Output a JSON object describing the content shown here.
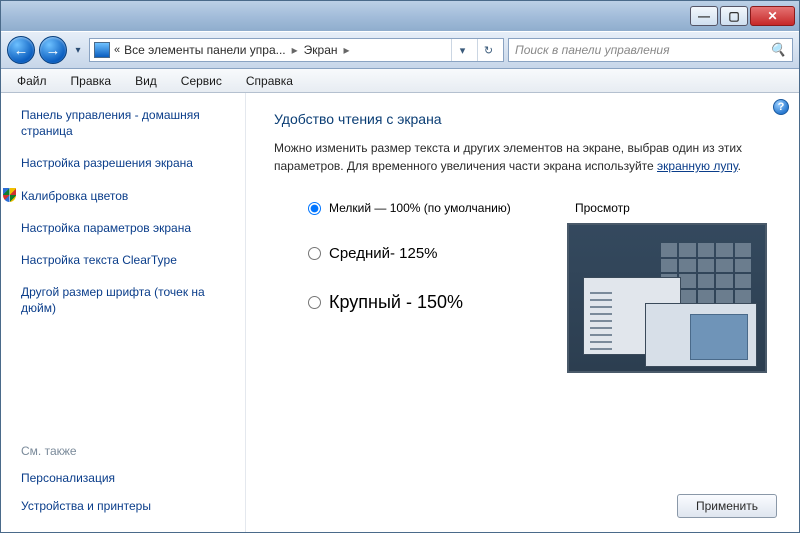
{
  "titlebar": {
    "minimize": "—",
    "maximize": "▢",
    "close": "✕"
  },
  "navbar": {
    "back": "←",
    "forward": "→",
    "history_dd": "▾",
    "address_chevrons": "«",
    "crumb_all": "Все элементы панели упра...",
    "crumb_screen": "Экран",
    "sep": "▸",
    "dd": "▾",
    "refresh": "↻"
  },
  "search": {
    "placeholder": "Поиск в панели управления",
    "icon": "🔍"
  },
  "menu": {
    "file": "Файл",
    "edit": "Правка",
    "view": "Вид",
    "tools": "Сервис",
    "help": "Справка"
  },
  "help_icon": "?",
  "sidebar": {
    "home": "Панель управления - домашняя страница",
    "resolution": "Настройка разрешения экрана",
    "calibration": "Калибровка цветов",
    "display_params": "Настройка параметров экрана",
    "cleartype": "Настройка текста ClearType",
    "font_dpi": "Другой размер шрифта (точек на дюйм)",
    "see_also": "См. также",
    "personalization": "Персонализация",
    "devices": "Устройства и принтеры"
  },
  "main": {
    "title": "Удобство чтения с экрана",
    "desc_1": "Можно изменить размер текста и других элементов на экране, выбрав один из этих параметров. Для временного увеличения части экрана используйте ",
    "magnifier_link": "экранную лупу",
    "desc_2": ".",
    "options": {
      "small": "Мелкий — 100% (по умолчанию)",
      "medium": "Средний- 125%",
      "large": "Крупный - 150%"
    },
    "preview_label": "Просмотр",
    "apply": "Применить"
  }
}
